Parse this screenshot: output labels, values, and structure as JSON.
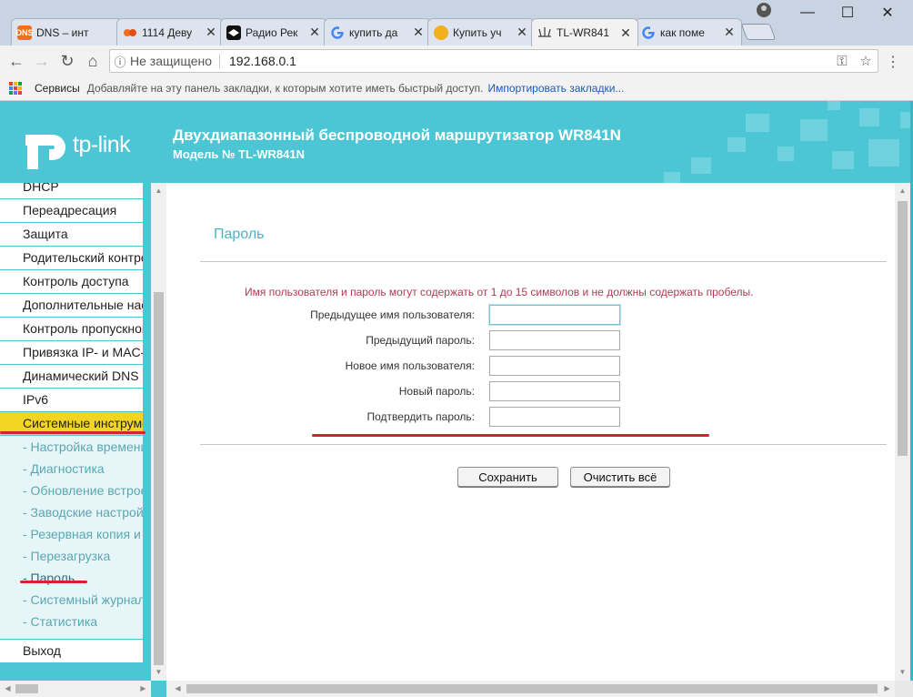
{
  "browser": {
    "tabs": [
      {
        "title": "DNS – инт",
        "icon": "dns-favicon",
        "color": "#f07020"
      },
      {
        "title": "1114 Деву",
        "icon": "dots-favicon",
        "color": "#f07020"
      },
      {
        "title": "Радио Рек",
        "icon": "radio-favicon",
        "color": "#111111"
      },
      {
        "title": "купить да",
        "icon": "google-favicon",
        "color": "#4285f4"
      },
      {
        "title": "Купить уч",
        "icon": "shop-favicon",
        "color": "#f2b01e"
      },
      {
        "title": "TL-WR841",
        "icon": "router-favicon",
        "color": "#444444",
        "active": true
      },
      {
        "title": "как поме",
        "icon": "google-favicon",
        "color": "#4285f4"
      }
    ],
    "tab_close_glyph": "✕",
    "address": {
      "security_label": "Не защищено",
      "url": "192.168.0.1"
    },
    "bookmarks": {
      "services_label": "Сервисы",
      "hint": "Добавляйте на эту панель закладки, к которым хотите иметь быстрый доступ.",
      "import_link": "Импортировать закладки..."
    }
  },
  "router": {
    "logo_text": "tp-link",
    "title": "Двухдиапазонный беспроводной маршрутизатор WR841N",
    "model": "Модель № TL-WR841N",
    "brand_color": "#4cc6d4",
    "menu": {
      "items": [
        "DHCP",
        "Переадресация",
        "Защита",
        "Родительский контроль",
        "Контроль доступа",
        "Дополнительные настройки маршрутизации",
        "Контроль пропускной способности",
        "Привязка IP- и MAC-адресов",
        "Динамический DNS",
        "IPv6",
        "Системные инструменты"
      ],
      "subitems": [
        "- Настройка времени",
        "- Диагностика",
        "- Обновление встроенного ПО",
        "- Заводские настройки",
        "- Резервная копия и восстановление",
        "- Перезагрузка",
        "- Пароль",
        "- Системный журнал",
        "- Статистика"
      ],
      "exit": "Выход"
    },
    "page": {
      "title": "Пароль",
      "note": "Имя пользователя и пароль могут содержать от 1 до 15 символов и не должны содержать пробелы.",
      "fields": {
        "old_user": {
          "label": "Предыдущее имя пользователя:",
          "value": ""
        },
        "old_pass": {
          "label": "Предыдущий пароль:",
          "value": ""
        },
        "new_user": {
          "label": "Новое имя пользователя:",
          "value": ""
        },
        "new_pass": {
          "label": "Новый пароль:",
          "value": ""
        },
        "confirm_pass": {
          "label": "Подтвердить пароль:",
          "value": ""
        }
      },
      "save_button": "Сохранить",
      "clear_button": "Очистить всё"
    }
  }
}
